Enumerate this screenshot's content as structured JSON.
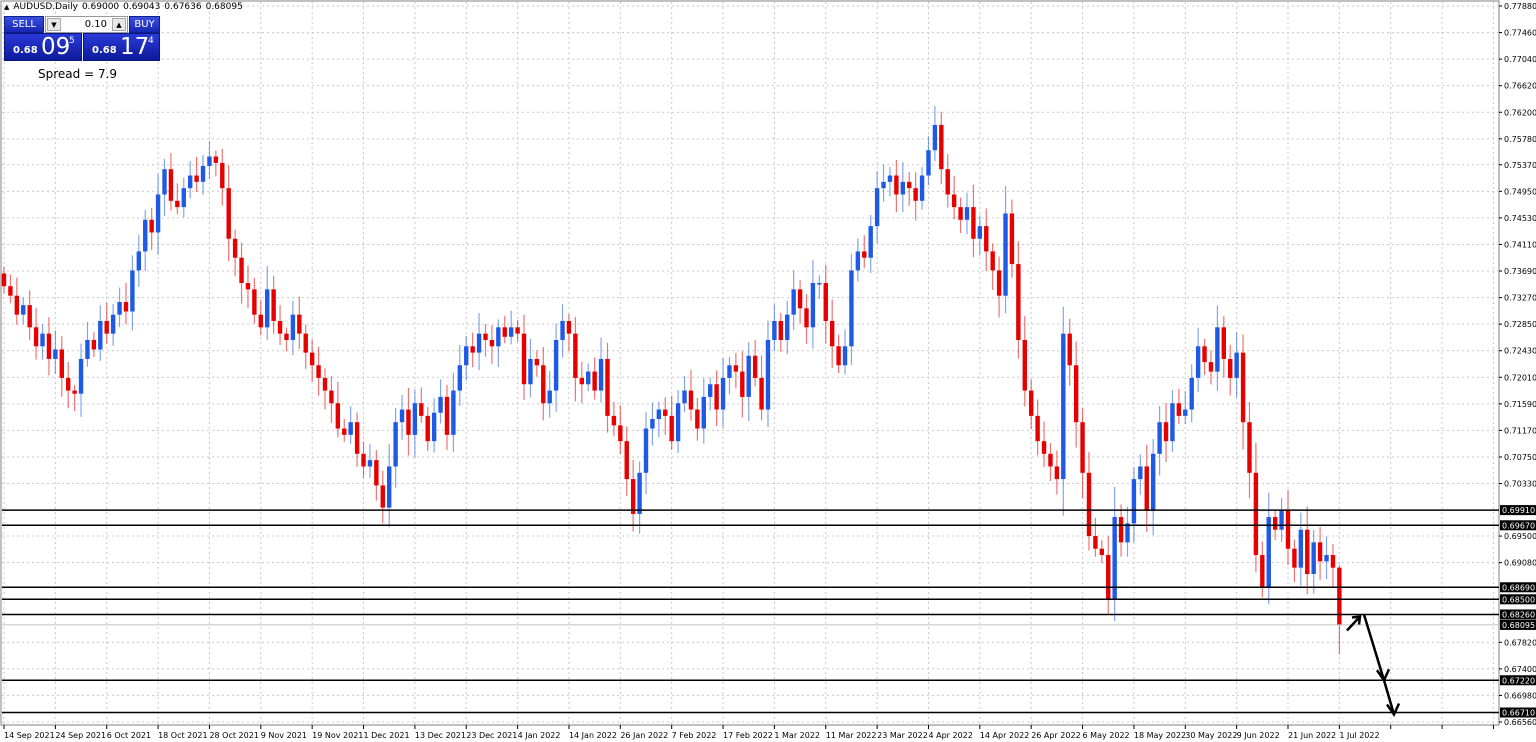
{
  "header": {
    "symbol": "AUDUSD.Daily",
    "open": "0.69000",
    "high": "0.69043",
    "low": "0.67636",
    "close": "0.68095"
  },
  "trade_panel": {
    "sell_label": "SELL",
    "buy_label": "BUY",
    "lot": "0.10",
    "sell_prefix": "0.68",
    "sell_big": "09",
    "sell_sup": "5",
    "buy_prefix": "0.68",
    "buy_big": "17",
    "buy_sup": "4",
    "spread": "Spread = 7.9"
  },
  "colors": {
    "bull": "#1e5ae6",
    "bear": "#e60000",
    "level": "#000000",
    "last": "#c0c0c0"
  },
  "chart_data": {
    "type": "candlestick",
    "title": "AUDUSD.Daily",
    "ylim": [
      0.6656,
      0.7788
    ],
    "y_ticks": [
      "0.77880",
      "0.77460",
      "0.77040",
      "0.76620",
      "0.76200",
      "0.75780",
      "0.75370",
      "0.74950",
      "0.74530",
      "0.74110",
      "0.73690",
      "0.73270",
      "0.72850",
      "0.72430",
      "0.72010",
      "0.71590",
      "0.71170",
      "0.70750",
      "0.70330",
      "0.69500",
      "0.69080",
      "0.67820",
      "0.67400",
      "0.66980",
      "0.66560"
    ],
    "levels": [
      "0.69910",
      "0.69670",
      "0.68690",
      "0.68500",
      "0.68260",
      "0.67220",
      "0.66710"
    ],
    "last_price": "0.68095",
    "x_labels": [
      "14 Sep 2021",
      "24 Sep 2021",
      "6 Oct 2021",
      "18 Oct 2021",
      "28 Oct 2021",
      "9 Nov 2021",
      "19 Nov 2021",
      "1 Dec 2021",
      "13 Dec 2021",
      "23 Dec 2021",
      "4 Jan 2022",
      "14 Jan 2022",
      "26 Jan 2022",
      "7 Feb 2022",
      "17 Feb 2022",
      "1 Mar 2022",
      "11 Mar 2022",
      "23 Mar 2022",
      "4 Apr 2022",
      "14 Apr 2022",
      "26 Apr 2022",
      "6 May 2022",
      "18 May 2022",
      "30 May 2022",
      "9 Jun 2022",
      "21 Jun 2022",
      "1 Jul 2022"
    ],
    "bars_per_label": 8,
    "first_open": 0.7365,
    "last_bar": {
      "open": 0.69,
      "high": 0.69043,
      "low": 0.67636,
      "close": 0.68095
    },
    "closes": [
      0.7345,
      0.733,
      0.73,
      0.7315,
      0.728,
      0.725,
      0.727,
      0.723,
      0.7245,
      0.72,
      0.718,
      0.7175,
      0.723,
      0.726,
      0.7245,
      0.729,
      0.727,
      0.73,
      0.732,
      0.7305,
      0.737,
      0.74,
      0.745,
      0.743,
      0.749,
      0.753,
      0.748,
      0.747,
      0.75,
      0.752,
      0.751,
      0.7535,
      0.755,
      0.754,
      0.75,
      0.742,
      0.739,
      0.735,
      0.734,
      0.73,
      0.728,
      0.734,
      0.729,
      0.727,
      0.726,
      0.73,
      0.727,
      0.724,
      0.722,
      0.72,
      0.718,
      0.716,
      0.712,
      0.711,
      0.713,
      0.708,
      0.706,
      0.707,
      0.703,
      0.6995,
      0.706,
      0.713,
      0.715,
      0.711,
      0.716,
      0.714,
      0.71,
      0.7145,
      0.717,
      0.711,
      0.718,
      0.722,
      0.725,
      0.724,
      0.727,
      0.726,
      0.725,
      0.728,
      0.7265,
      0.728,
      0.727,
      0.719,
      0.723,
      0.722,
      0.716,
      0.718,
      0.726,
      0.729,
      0.727,
      0.72,
      0.719,
      0.721,
      0.718,
      0.723,
      0.714,
      0.7125,
      0.71,
      0.704,
      0.6985,
      0.705,
      0.712,
      0.7135,
      0.715,
      0.714,
      0.71,
      0.716,
      0.718,
      0.715,
      0.712,
      0.717,
      0.719,
      0.715,
      0.72,
      0.722,
      0.721,
      0.717,
      0.7235,
      0.72,
      0.715,
      0.726,
      0.729,
      0.726,
      0.73,
      0.734,
      0.731,
      0.728,
      0.735,
      0.735,
      0.729,
      0.725,
      0.722,
      0.725,
      0.737,
      0.74,
      0.739,
      0.744,
      0.75,
      0.751,
      0.752,
      0.749,
      0.751,
      0.75,
      0.748,
      0.752,
      0.756,
      0.76,
      0.753,
      0.749,
      0.747,
      0.745,
      0.747,
      0.742,
      0.744,
      0.74,
      0.737,
      0.733,
      0.746,
      0.738,
      0.726,
      0.718,
      0.714,
      0.71,
      0.708,
      0.706,
      0.704,
      0.727,
      0.722,
      0.713,
      0.705,
      0.695,
      0.693,
      0.692,
      0.685,
      0.698,
      0.694,
      0.697,
      0.704,
      0.706,
      0.699,
      0.708,
      0.713,
      0.71,
      0.716,
      0.714,
      0.715,
      0.72,
      0.725,
      0.7225,
      0.721,
      0.728,
      0.723,
      0.72,
      0.724,
      0.713,
      0.705,
      0.692,
      0.687,
      0.698,
      0.696,
      0.699,
      0.693,
      0.69,
      0.696,
      0.689,
      0.694,
      0.691,
      0.692,
      0.69,
      0.68095
    ]
  }
}
